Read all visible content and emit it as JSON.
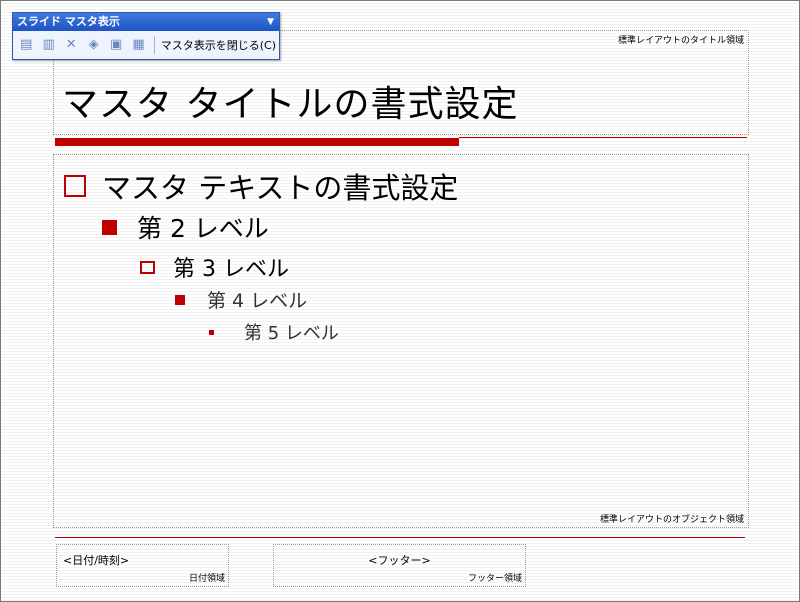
{
  "toolbar": {
    "title": "スライド マスタ表示",
    "dropdown_arrow": "▼",
    "buttons": [
      {
        "name": "insert-slide-master-icon",
        "glyph": "▤"
      },
      {
        "name": "insert-title-master-icon",
        "glyph": "▥"
      },
      {
        "name": "delete-master-icon",
        "glyph": "✕"
      },
      {
        "name": "preserve-master-icon",
        "glyph": "◈"
      },
      {
        "name": "rename-master-icon",
        "glyph": "▣"
      },
      {
        "name": "master-layout-icon",
        "glyph": "▦"
      }
    ],
    "close_label": "マスタ表示を閉じる(C)"
  },
  "slide": {
    "title_area": {
      "tag": "標準レイアウトのタイトル領域",
      "title": "マスタ タイトルの書式設定"
    },
    "object_area": {
      "tag": "標準レイアウトのオブジェクト領域",
      "levels": [
        "マスタ テキストの書式設定",
        "第 2 レベル",
        "第 3 レベル",
        "第 4 レベル",
        "第 5 レベル"
      ]
    },
    "date_area": {
      "text": "<日付/時刻>",
      "tag": "日付領域"
    },
    "footer_area": {
      "text": "<フッター>",
      "tag": "フッター領域"
    }
  },
  "colors": {
    "accent": "#c00000",
    "toolbar_title": "#1f53c4"
  }
}
